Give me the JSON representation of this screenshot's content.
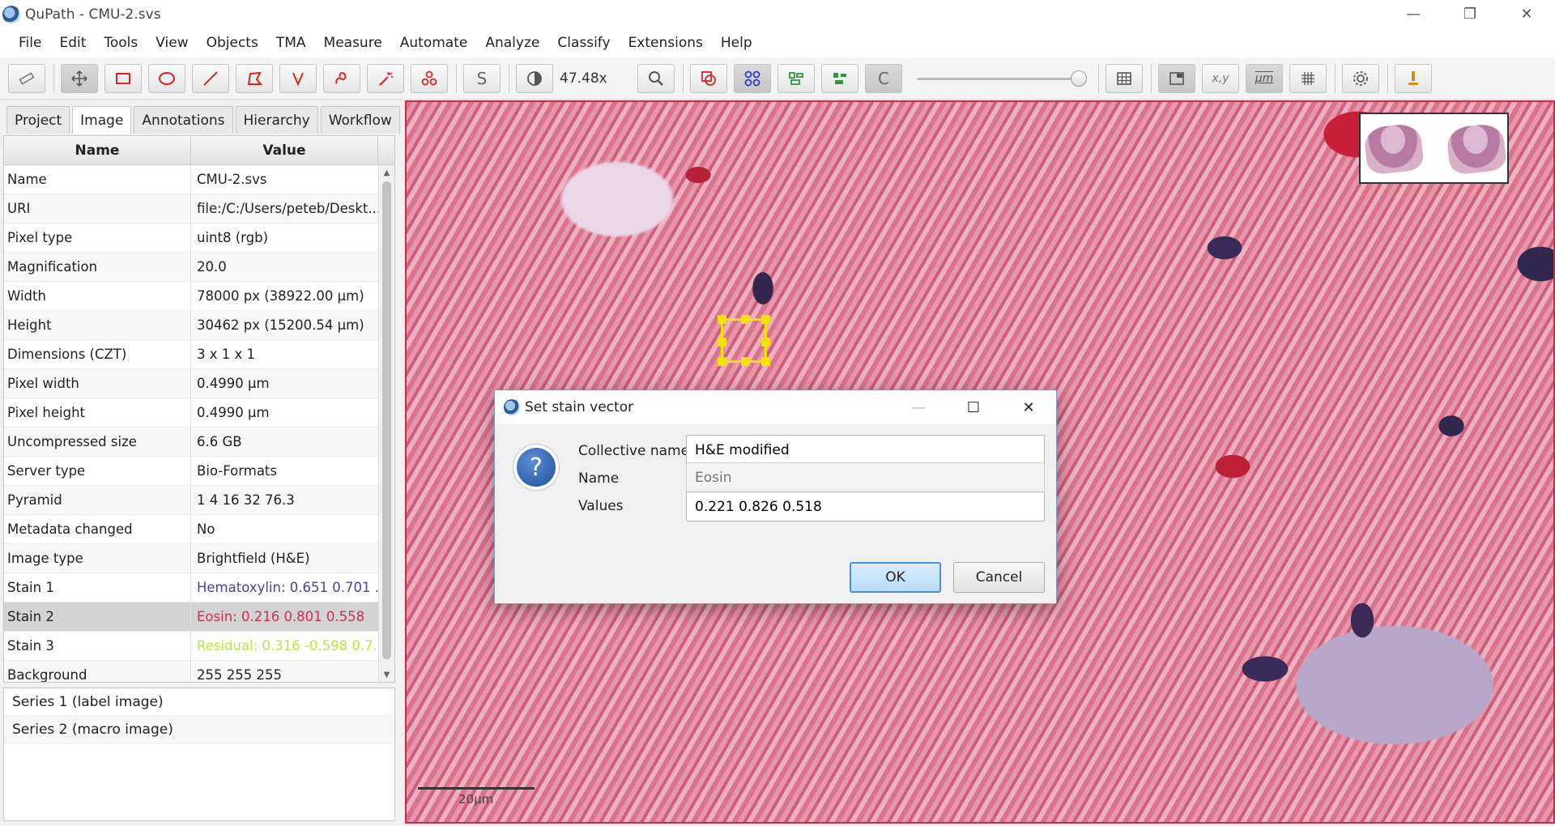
{
  "window": {
    "title": "QuPath - CMU-2.svs",
    "minimize": "—",
    "restore": "❐",
    "close": "✕"
  },
  "menu": [
    "File",
    "Edit",
    "Tools",
    "View",
    "Objects",
    "TMA",
    "Measure",
    "Automate",
    "Analyze",
    "Classify",
    "Extensions",
    "Help"
  ],
  "toolbar": {
    "zoom_label": "47.48x",
    "opacity": 1.0,
    "coords_label": "x,y",
    "micron_label": "µm",
    "s_label": "S",
    "c_label": "C"
  },
  "tabs": [
    "Project",
    "Image",
    "Annotations",
    "Hierarchy",
    "Workflow"
  ],
  "table": {
    "headers": [
      "Name",
      "Value"
    ],
    "rows": [
      [
        "Name",
        "CMU-2.svs"
      ],
      [
        "URI",
        "file:/C:/Users/peteb/Deskt..."
      ],
      [
        "Pixel type",
        "uint8 (rgb)"
      ],
      [
        "Magnification",
        "20.0"
      ],
      [
        "Width",
        "78000 px (38922.00 µm)"
      ],
      [
        "Height",
        "30462 px (15200.54 µm)"
      ],
      [
        "Dimensions (CZT)",
        "3 x 1 x 1"
      ],
      [
        "Pixel width",
        "0.4990 µm"
      ],
      [
        "Pixel height",
        "0.4990 µm"
      ],
      [
        "Uncompressed size",
        "6.6 GB"
      ],
      [
        "Server type",
        "Bio-Formats"
      ],
      [
        "Pyramid",
        "1 4 16 32 76.3"
      ],
      [
        "Metadata changed",
        "No"
      ],
      [
        "Image type",
        "Brightfield (H&E)"
      ],
      [
        "Stain 1",
        "Hematoxylin: 0.651 0.701 ..."
      ],
      [
        "Stain 2",
        "Eosin: 0.216 0.801 0.558"
      ],
      [
        "Stain 3",
        "Residual: 0.316 -0.598 0.7..."
      ],
      [
        "Background",
        "255 255 255"
      ]
    ]
  },
  "stain_colors": {
    "stain1": "#4b3fa0",
    "stain2": "#d0304a",
    "stain3": "#b8e83a"
  },
  "series": [
    "Series 1 (label image)",
    "Series 2 (macro image)"
  ],
  "viewer": {
    "scalebar_label": "20µm"
  },
  "dialog": {
    "title": "Set stain vector",
    "fields": {
      "collective_label": "Collective name",
      "collective_value": "H&E modified",
      "name_label": "Name",
      "name_placeholder": "Eosin",
      "values_label": "Values",
      "values_value": "0.221 0.826 0.518"
    },
    "ok": "OK",
    "cancel": "Cancel"
  }
}
